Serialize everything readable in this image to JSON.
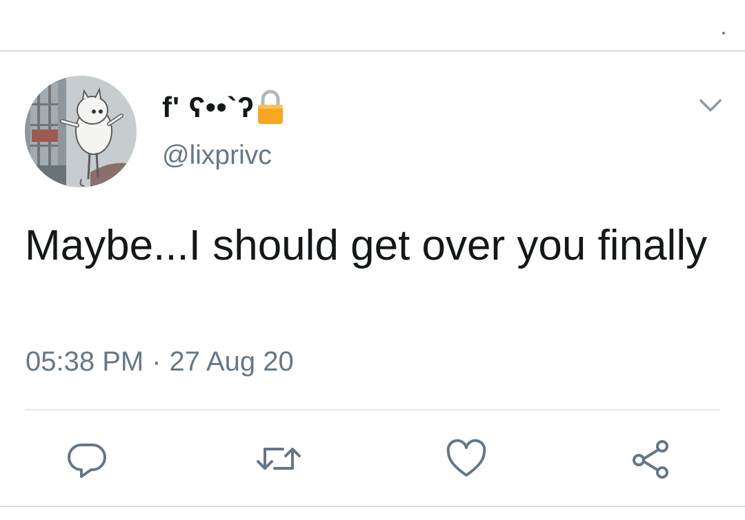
{
  "tweet": {
    "display_name": "f' ʕ••`ʔ",
    "handle": "@lixprivc",
    "text": "Maybe...I should get over you finally",
    "time": "05:38 PM",
    "separator": "·",
    "date": "27 Aug 20",
    "protected": true
  },
  "icons": {
    "lock": "lock-icon",
    "chevron": "chevron-down-icon",
    "reply": "reply-icon",
    "retweet": "retweet-icon",
    "like": "heart-icon",
    "share": "share-icon"
  },
  "colors": {
    "text_primary": "#14171a",
    "text_secondary": "#657786",
    "icon": "#657786",
    "lock": "#f5a623",
    "divider": "#e1e8ed"
  }
}
